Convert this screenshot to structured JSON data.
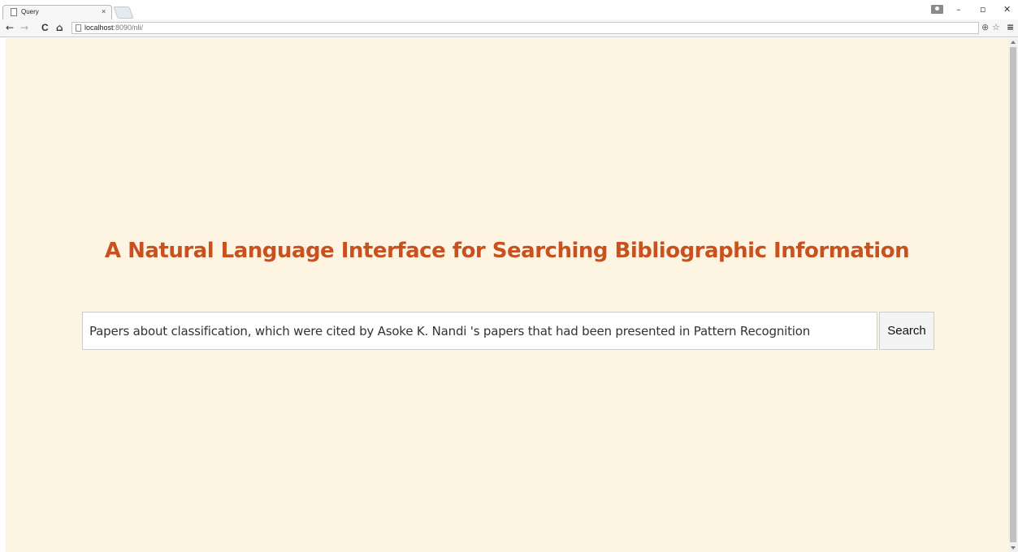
{
  "browser": {
    "tab_title": "Query",
    "tab_close": "×",
    "url_host": "localhost",
    "url_rest": ":8090/nli/",
    "back_glyph": "←",
    "forward_glyph": "→",
    "reload_glyph": "C",
    "home_glyph": "⌂",
    "zoom_glyph": "⊕",
    "star_glyph": "☆",
    "menu_glyph": "≡",
    "minimize_glyph": "–",
    "restore_glyph": "▫",
    "close_glyph": "✕",
    "icons": [
      "page-icon",
      "back-icon",
      "forward-icon",
      "reload-icon",
      "home-icon",
      "zoom-icon",
      "bookmark-star-icon",
      "menu-icon",
      "profile-icon"
    ]
  },
  "page": {
    "title": "A Natural Language Interface for Searching Bibliographic Information",
    "query_value": "Papers about classification, which were cited by Asoke K. Nandi 's papers that had been presented in Pattern Recognition",
    "search_label": "Search"
  },
  "colors": {
    "background": "#fdf5e2",
    "title": "#c9511f"
  }
}
